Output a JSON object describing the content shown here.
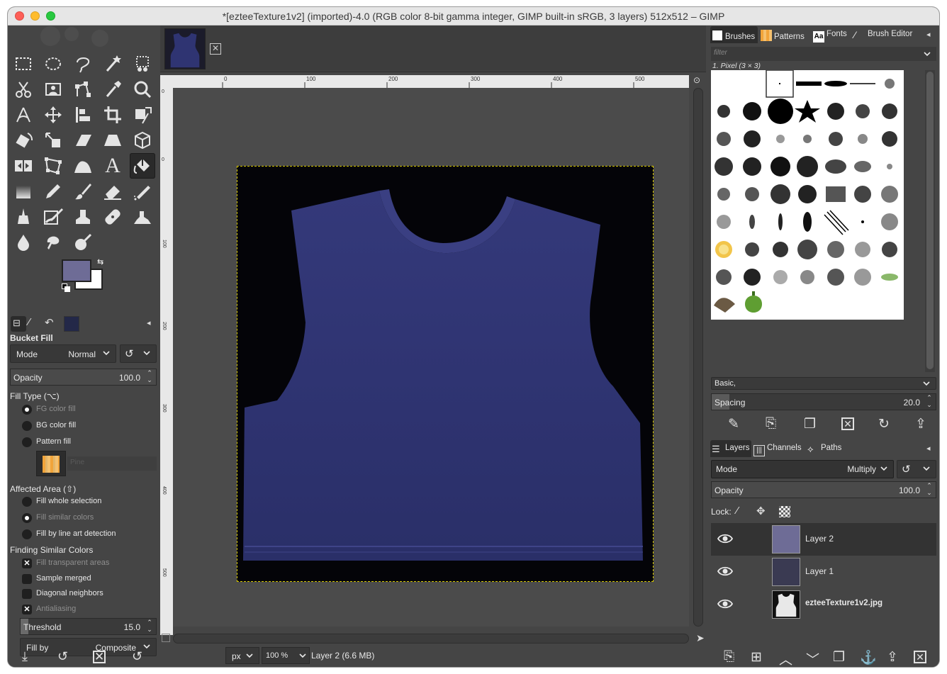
{
  "window": {
    "title": "*[ezteeTexture1v2] (imported)-4.0 (RGB color 8-bit gamma integer, GIMP built-in sRGB, 3 layers) 512x512 – GIMP"
  },
  "toolbox": {
    "tool_names": [
      "rect-select",
      "ellipse-select",
      "free-select",
      "fuzzy-select",
      "by-color-select",
      "scissors",
      "foreground-select",
      "paths",
      "color-picker",
      "zoom",
      "measure",
      "move",
      "align",
      "crop",
      "unified-transform",
      "rotate",
      "shear",
      "perspective",
      "3d-transform",
      "flip",
      "cage",
      "warp",
      "text",
      "bucket-fill",
      "gradient",
      "pencil",
      "paintbrush",
      "eraser",
      "airbrush",
      "ink",
      "mypaint-brush",
      "clone",
      "heal",
      "perspective-clone",
      "smudge",
      "blur",
      "dodge"
    ],
    "fg_color": "#6e6c96",
    "bg_color": "#ffffff"
  },
  "tool_options": {
    "title": "Bucket Fill",
    "mode_label": "Mode",
    "mode_value": "Normal",
    "opacity_label": "Opacity",
    "opacity_value": "100.0",
    "fill_type_label": "Fill Type  (⌥)",
    "fill_types": [
      "FG color fill",
      "BG color fill",
      "Pattern fill"
    ],
    "pattern_name": "Pine",
    "affected_area_label": "Affected Area  (⇧)",
    "affected_areas": [
      "Fill whole selection",
      "Fill similar colors",
      "Fill by line art detection"
    ],
    "finding_label": "Finding Similar Colors",
    "finding_opts": [
      "Fill transparent areas",
      "Sample merged",
      "Diagonal neighbors",
      "Antialiasing"
    ],
    "threshold_label": "Threshold",
    "threshold_value": "15.0",
    "fillby_label": "Fill by",
    "fillby_value": "Composite"
  },
  "canvas": {
    "ruler_marks": [
      "0",
      "100",
      "200",
      "300",
      "400",
      "500"
    ],
    "vruler_marks": [
      "0",
      "0",
      "100",
      "200",
      "300",
      "400",
      "500"
    ],
    "unit": "px",
    "zoom": "100 %",
    "status": "Layer 2 (6.6 MB)",
    "shirt_color": "#2f3472"
  },
  "brushes_panel": {
    "tabs": [
      "Brushes",
      "Patterns",
      "Fonts",
      "Brush Editor"
    ],
    "filter_placeholder": "filter",
    "selected_brush": "1. Pixel (3 × 3)",
    "preset": "Basic,",
    "spacing_label": "Spacing",
    "spacing_value": "20.0"
  },
  "layers_panel": {
    "tabs": [
      "Layers",
      "Channels",
      "Paths"
    ],
    "mode_label": "Mode",
    "mode_value": "Multiply",
    "opacity_label": "Opacity",
    "opacity_value": "100.0",
    "lock_label": "Lock:",
    "layers": [
      {
        "name": "Layer 2",
        "thumb": "#6e6c96"
      },
      {
        "name": "Layer 1",
        "thumb": "#3a3a52"
      },
      {
        "name": "ezteeTexture1v2.jpg",
        "thumb": "#111111"
      }
    ]
  }
}
